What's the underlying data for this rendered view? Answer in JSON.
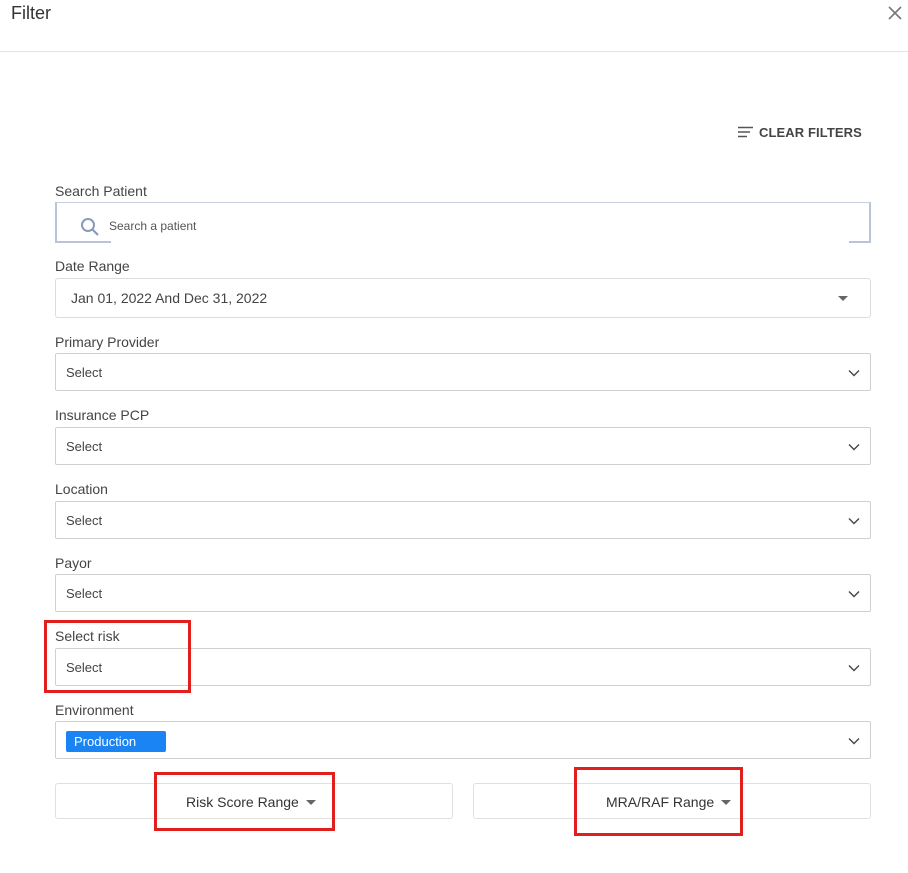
{
  "dialog": {
    "title": "Filter",
    "close_icon": "close-icon"
  },
  "toolbar": {
    "clear_filters_label": "CLEAR FILTERS",
    "clear_filters_icon": "sort-lines-icon"
  },
  "fields": {
    "search_patient": {
      "label": "Search Patient",
      "placeholder": "Search a patient",
      "value": ""
    },
    "date_range": {
      "label": "Date Range",
      "value": "Jan 01, 2022 And Dec 31, 2022"
    },
    "primary_provider": {
      "label": "Primary Provider",
      "value": "Select"
    },
    "insurance_pcp": {
      "label": "Insurance PCP",
      "value": "Select"
    },
    "location": {
      "label": "Location",
      "value": "Select"
    },
    "payor": {
      "label": "Payor",
      "value": "Select"
    },
    "select_risk": {
      "label": "Select risk",
      "value": "Select"
    },
    "environment": {
      "label": "Environment",
      "selected_tag": "Production"
    }
  },
  "ranges": {
    "risk_score": "Risk Score Range",
    "mra_raf": "MRA/RAF Range"
  },
  "colors": {
    "accent": "#1a84f5",
    "highlight": "#e0201c",
    "border": "#d0d0d0",
    "text": "#444444"
  }
}
